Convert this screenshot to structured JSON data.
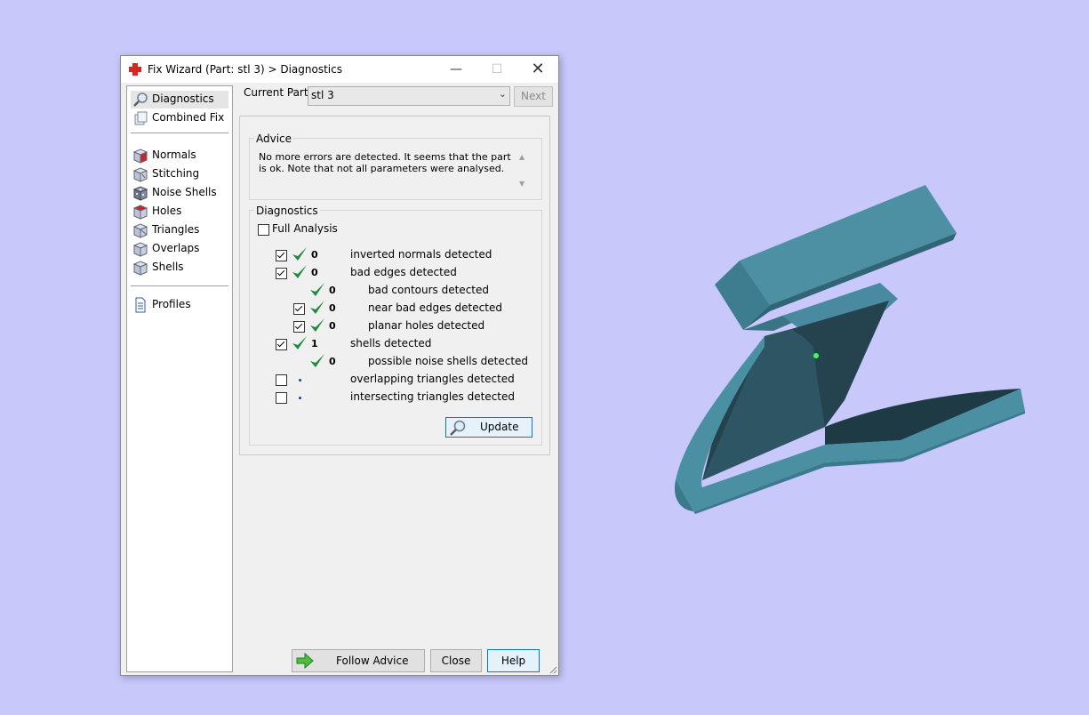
{
  "window": {
    "title": "Fix Wizard (Part: stl 3) > Diagnostics"
  },
  "nav": {
    "items": [
      {
        "label": "Diagnostics",
        "icon": "magnifier-icon"
      },
      {
        "label": "Combined Fix",
        "icon": "combined-fix-icon"
      },
      {
        "label": "Normals",
        "icon": "normals-cube-icon"
      },
      {
        "label": "Stitching",
        "icon": "stitching-cube-icon"
      },
      {
        "label": "Noise Shells",
        "icon": "noise-shells-icon"
      },
      {
        "label": "Holes",
        "icon": "holes-cube-icon"
      },
      {
        "label": "Triangles",
        "icon": "triangles-cube-icon"
      },
      {
        "label": "Overlaps",
        "icon": "overlaps-cube-icon"
      },
      {
        "label": "Shells",
        "icon": "shells-cube-icon"
      },
      {
        "label": "Profiles",
        "icon": "document-icon"
      }
    ],
    "selected": "Diagnostics"
  },
  "header": {
    "current_part_label": "Current Part:",
    "current_part_value": "stl 3",
    "next_label": "Next"
  },
  "advice": {
    "title": "Advice",
    "text": "No more errors are detected. It seems that the part is ok. Note that not all parameters were analysed."
  },
  "diagnostics": {
    "title": "Diagnostics",
    "full_analysis_label": "Full Analysis",
    "full_analysis_checked": false,
    "rows": [
      {
        "label": "inverted normals detected",
        "count": "0",
        "checked": true,
        "status": "ok"
      },
      {
        "label": "bad edges detected",
        "count": "0",
        "checked": true,
        "status": "ok"
      },
      {
        "label": "bad contours detected",
        "count": "0",
        "checked": null,
        "status": "ok"
      },
      {
        "label": "near bad edges detected",
        "count": "0",
        "checked": true,
        "status": "ok"
      },
      {
        "label": "planar holes detected",
        "count": "0",
        "checked": true,
        "status": "ok"
      },
      {
        "label": "shells detected",
        "count": "1",
        "checked": true,
        "status": "ok"
      },
      {
        "label": "possible noise shells detected",
        "count": "0",
        "checked": null,
        "status": "ok"
      },
      {
        "label": "overlapping triangles detected",
        "count": "",
        "checked": false,
        "status": "unknown"
      },
      {
        "label": "intersecting triangles detected",
        "count": "",
        "checked": false,
        "status": "unknown"
      }
    ],
    "update_label": "Update"
  },
  "footer": {
    "follow_advice_label": "Follow Advice",
    "close_label": "Close",
    "help_label": "Help"
  },
  "colors": {
    "background": "#c8c8fb",
    "model": "#4a8fa0",
    "check_green": "#1f8a3c"
  }
}
